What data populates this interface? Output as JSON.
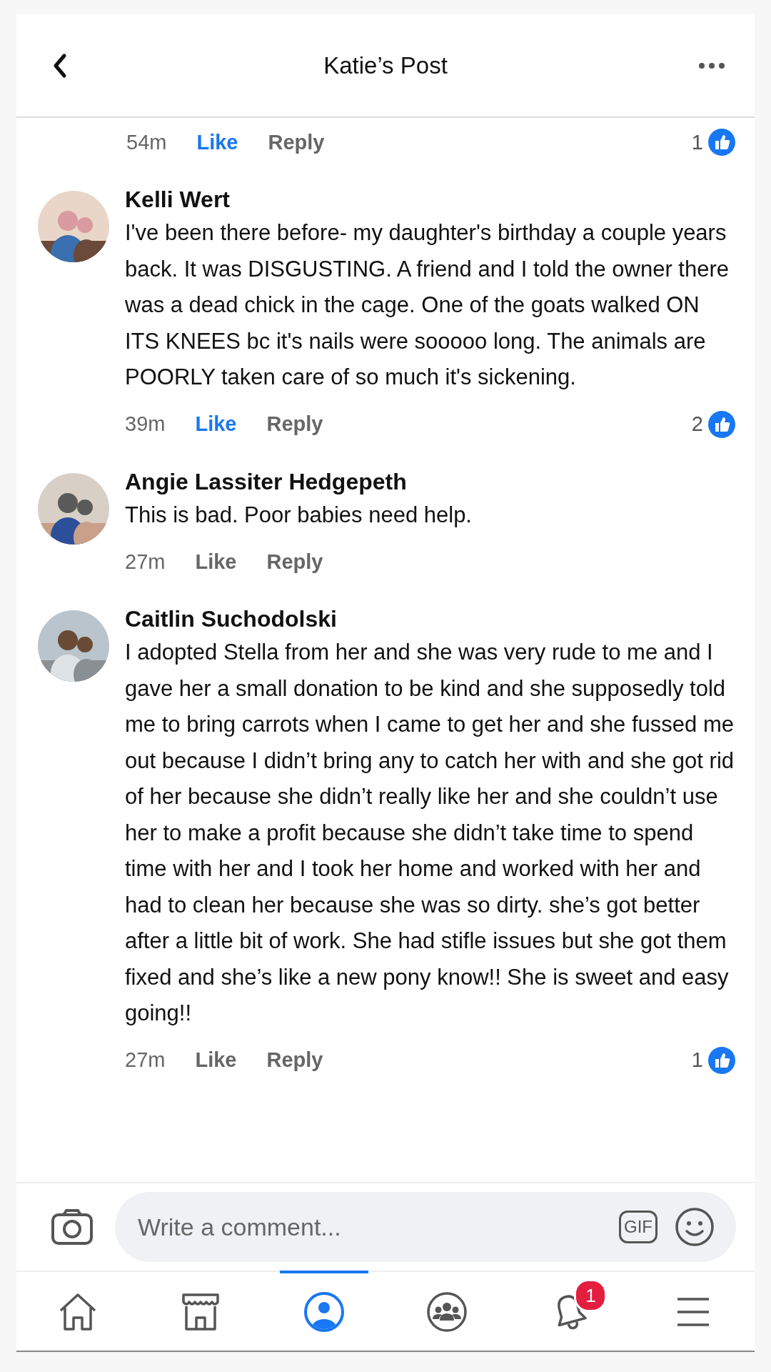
{
  "header": {
    "title": "Katie’s Post"
  },
  "top_actions": {
    "time": "54m",
    "like": "Like",
    "reply": "Reply",
    "liked": true,
    "reactions": "1"
  },
  "comments": [
    {
      "author": "Kelli Wert",
      "text": "I've been there before- my daughter's birthday a couple years back. It was DISGUSTING. A friend and I told the owner there was a dead chick in the cage. One of the goats walked ON ITS KNEES bc it's nails were sooooo long. The animals are POORLY taken care of so much it's sickening.",
      "time": "39m",
      "like": "Like",
      "reply": "Reply",
      "liked": true,
      "reactions": "2"
    },
    {
      "author": "Angie Lassiter Hedgepeth",
      "text": "This is bad. Poor babies need help.",
      "time": "27m",
      "like": "Like",
      "reply": "Reply",
      "liked": false
    },
    {
      "author": "Caitlin Suchodolski",
      "text": "I adopted Stella from her and she was very rude to me and I gave her a small donation to be kind and she supposedly told me to bring carrots when I came to get her and she fussed me out because I didn’t bring any to catch her with and she got rid of her because she didn’t really like her and she couldn’t use her to make a profit because she didn’t take time to spend time with her and I took her home and worked with her and had to clean her because she was so dirty. she’s got better after a little bit of work. She had stifle issues but she got them fixed and she’s like a new pony know!! She is sweet and easy going!!",
      "time": "27m",
      "like": "Like",
      "reply": "Reply",
      "liked": false,
      "reactions": "1"
    }
  ],
  "composer": {
    "placeholder": "Write a comment...",
    "gif": "GIF"
  },
  "nav": [
    {
      "kind": "home",
      "selected": false
    },
    {
      "kind": "store",
      "selected": false
    },
    {
      "kind": "profile",
      "selected": true
    },
    {
      "kind": "groups",
      "selected": false
    },
    {
      "kind": "bell",
      "selected": false,
      "badge": "1"
    },
    {
      "kind": "menu",
      "selected": false
    }
  ]
}
